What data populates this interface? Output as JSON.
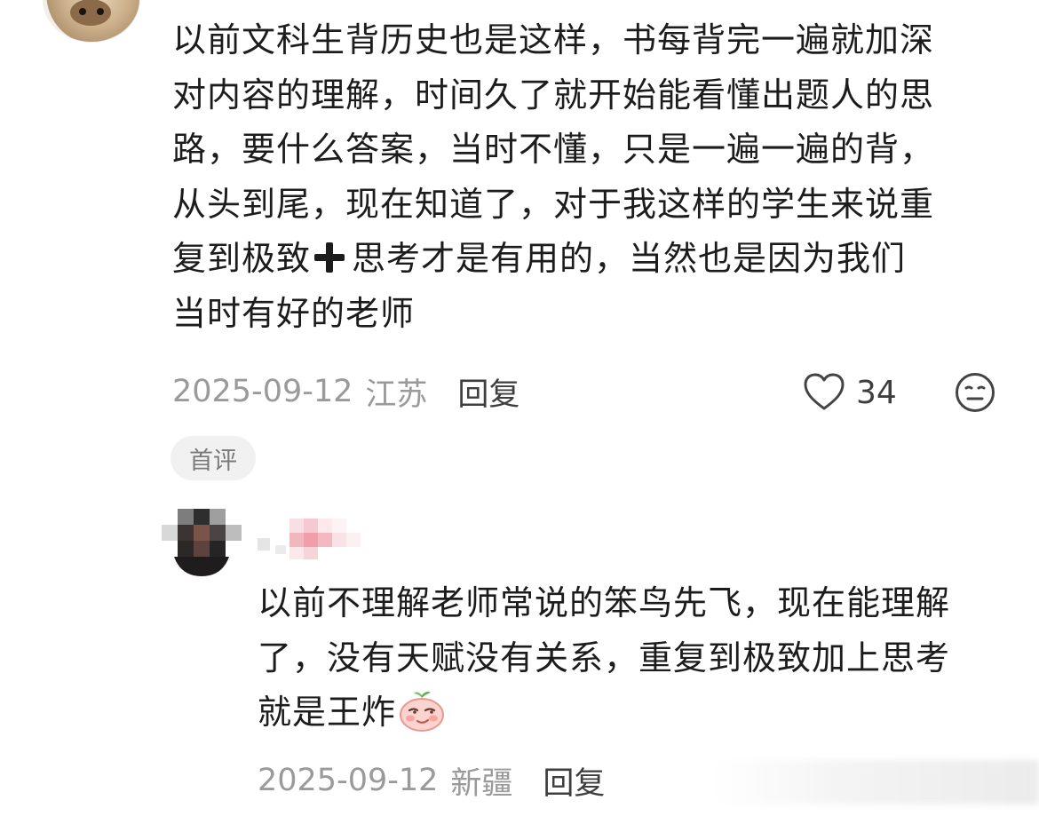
{
  "comment": {
    "lines": [
      "以前文科生背历史也是这样，书每背完一遍就加深",
      "对内容的理解，时间久了就开始能看懂出题人的思",
      "路，要什么答案，当时不懂，只是一遍一遍的背，",
      "从头到尾，现在知道了，对于我这样的学生来说重",
      "复到极致",
      "思考才是有用的，当然也是因为我们",
      "当时有好的老师"
    ],
    "plus_icon": "heavy-plus-emoji",
    "date": "2025-09-12",
    "location": "江苏",
    "reply_label": "回复",
    "likes": "34",
    "like_icon": "heart-outline-icon",
    "dislike_icon": "meh-face-icon",
    "tag": "首评"
  },
  "reply": {
    "lines": [
      "以前不理解老师常说的笨鸟先飞，现在能理解",
      "了，没有天赋没有关系，重复到极致加上思考",
      "就是王炸"
    ],
    "emoji": "smirking-peach-emoji",
    "date": "2025-09-12",
    "location": "新疆",
    "reply_label": "回复"
  }
}
